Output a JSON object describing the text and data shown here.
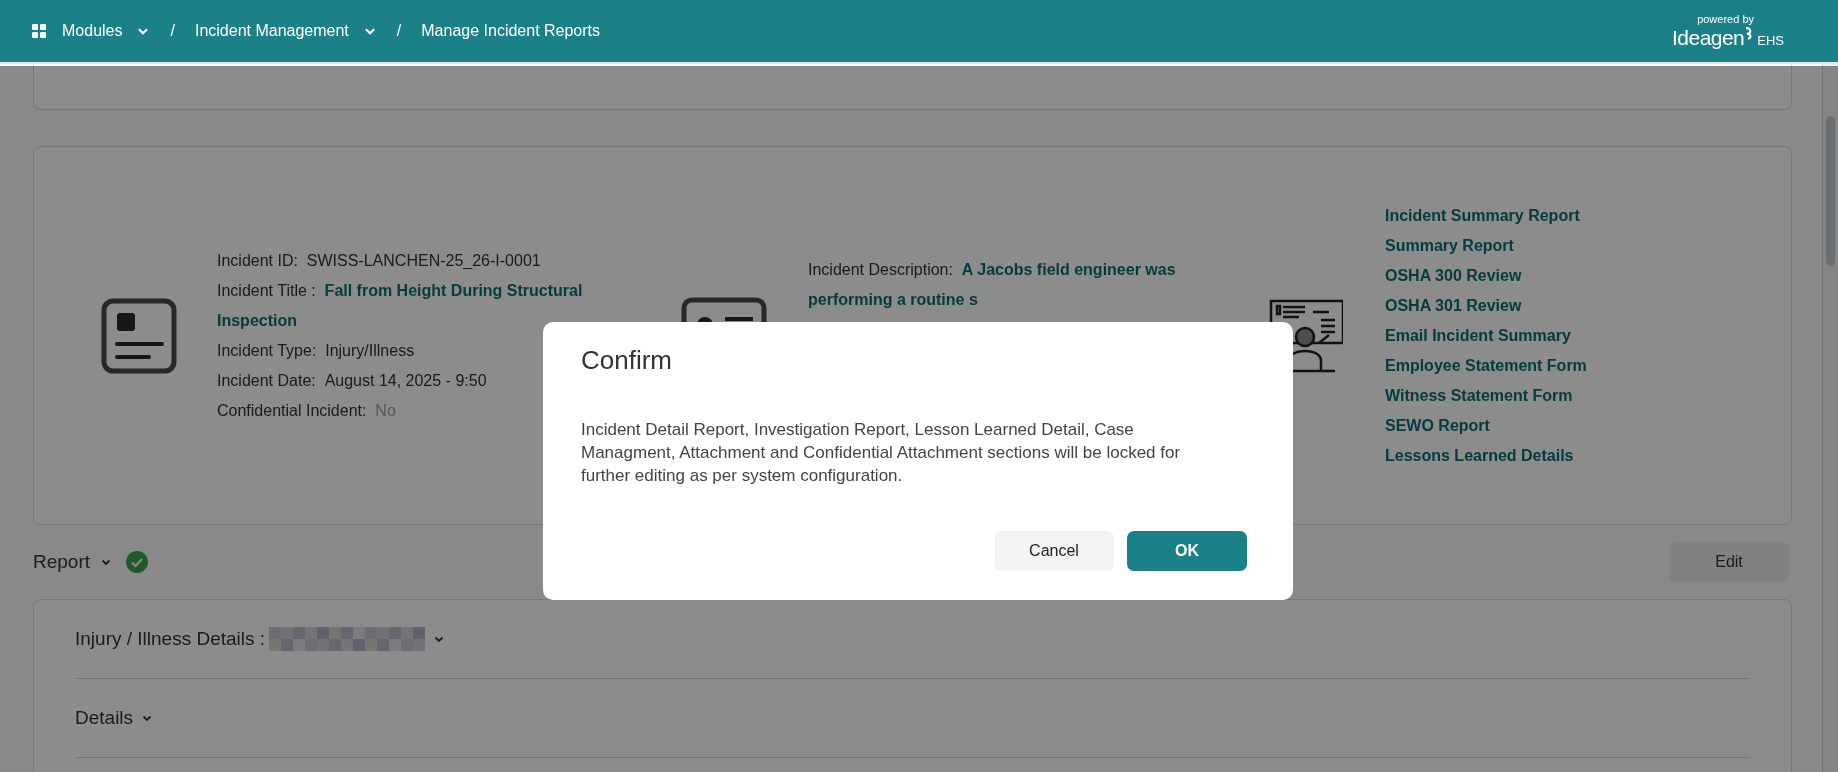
{
  "header": {
    "breadcrumbs": [
      {
        "label": "Modules",
        "dropdown": true,
        "separator": "/"
      },
      {
        "label": "Incident Management",
        "dropdown": true,
        "separator": "/"
      },
      {
        "label": "Manage Incident Reports",
        "dropdown": false
      }
    ],
    "brand": {
      "tagline": "powered by",
      "name": "Ideagen",
      "suffix": "EHS"
    }
  },
  "incident": {
    "fields": [
      {
        "label": "Incident ID:",
        "value": "SWISS-LANCHEN-25_26-I-0001",
        "kind": "plain"
      },
      {
        "label": "Incident Title :",
        "value": "Fall from Height During Structural Inspection",
        "kind": "link"
      },
      {
        "label": "Incident Type:",
        "value": "Injury/Illness",
        "kind": "plain"
      },
      {
        "label": "Incident Date:",
        "value": "August 14, 2025 - 9:50",
        "kind": "plain"
      },
      {
        "label": "Confidential Incident:",
        "value": "No",
        "kind": "muted"
      }
    ],
    "description": {
      "label": "Incident Description:",
      "value": "A Jacobs field engineer was performing a routine s"
    },
    "reports": [
      "Incident Summary Report",
      "Summary Report",
      "OSHA 300 Review",
      "OSHA 301 Review",
      "Email Incident Summary",
      "Employee Statement Form",
      "Witness Statement Form",
      "SEWO Report",
      "Lessons Learned Details"
    ]
  },
  "report_section": {
    "title": "Report",
    "complete": true,
    "edit_button": "Edit",
    "sections": [
      {
        "title": "Injury / Illness Details :",
        "redacted": true
      },
      {
        "title": "Details",
        "redacted": false
      }
    ]
  },
  "dialog": {
    "title": "Confirm",
    "message": "Incident Detail Report, Investigation Report, Lesson Learned Detail, Case Managment, Attachment and Confidential Attachment sections will be locked for further editing as per system configuration.",
    "buttons": [
      {
        "label": "Cancel",
        "kind": "secondary"
      },
      {
        "label": "OK",
        "kind": "primary"
      }
    ]
  }
}
